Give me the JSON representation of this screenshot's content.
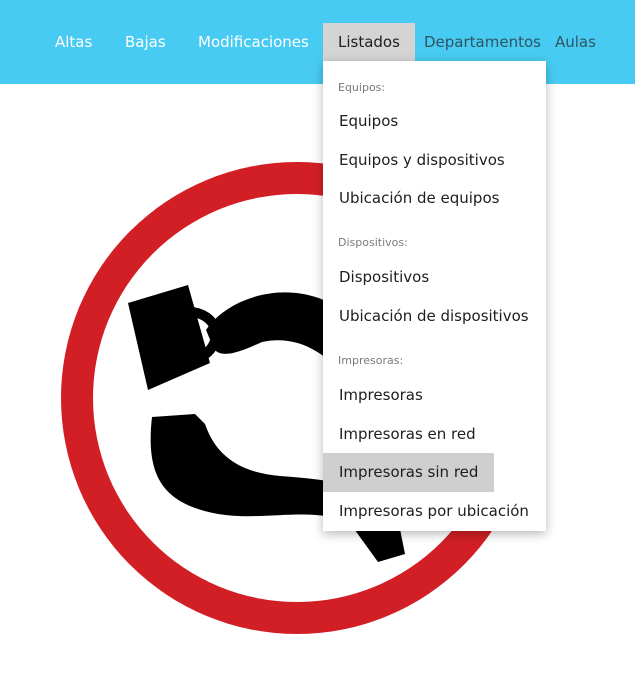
{
  "nav": {
    "items": [
      {
        "label": "Altas"
      },
      {
        "label": "Bajas"
      },
      {
        "label": "Modificaciones"
      },
      {
        "label": "Listados"
      },
      {
        "label": "Departamentos"
      },
      {
        "label": "Aulas"
      }
    ]
  },
  "dropdown": {
    "sections": [
      {
        "header": "Equipos:",
        "items": [
          "Equipos",
          "Equipos y dispositivos",
          "Ubicación de equipos"
        ]
      },
      {
        "header": "Dispositivos:",
        "items": [
          "Dispositivos",
          "Ubicación de dispositivos"
        ]
      },
      {
        "header": "Impresoras:",
        "items": [
          "Impresoras",
          "Impresoras en red",
          "Impresoras sin red",
          "Impresoras por ubicación"
        ]
      }
    ],
    "highlighted_item": "Impresoras sin red"
  },
  "colors": {
    "navbar": "#48cbf2",
    "active_tab": "#d4d4d4",
    "hover_item": "#cfcfcf",
    "sign_red": "#d21f26",
    "sign_black": "#000000"
  },
  "hero_image": {
    "icon": "no-coffee-sign-icon"
  }
}
